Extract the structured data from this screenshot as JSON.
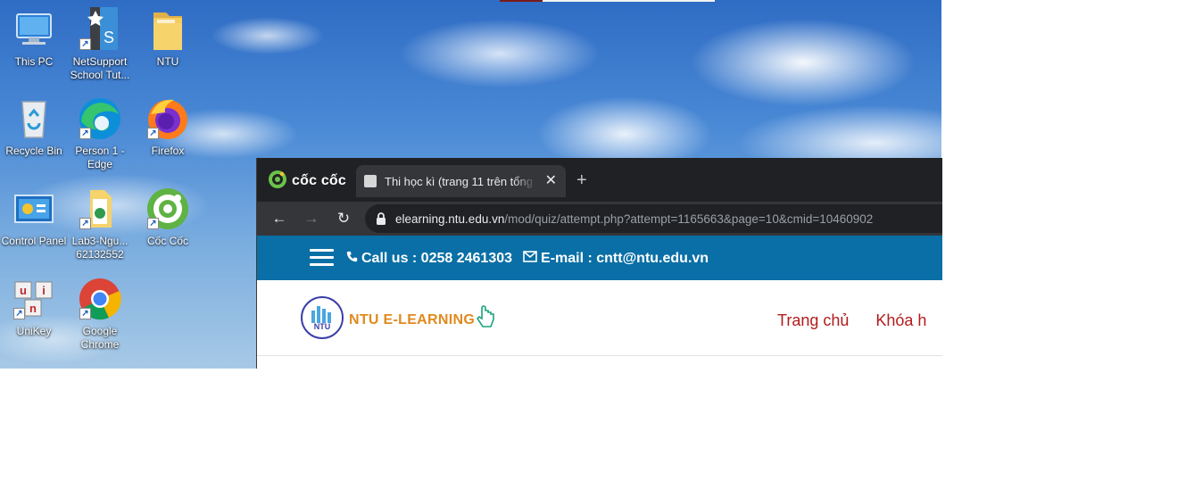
{
  "desktop": {
    "icons": [
      {
        "label": "This PC",
        "icon": "this-pc-icon"
      },
      {
        "label": "NetSupport School Tut...",
        "icon": "netsupport-icon"
      },
      {
        "label": "NTU",
        "icon": "folder-icon"
      },
      {
        "label": "Recycle Bin",
        "icon": "recycle-bin-icon"
      },
      {
        "label": "Person 1 - Edge",
        "icon": "edge-icon"
      },
      {
        "label": "Firefox",
        "icon": "firefox-icon"
      },
      {
        "label": "Control Panel",
        "icon": "control-panel-icon"
      },
      {
        "label": "Lab3-Ngu... 62132552",
        "icon": "document-icon"
      },
      {
        "label": "Cốc Cốc",
        "icon": "coccoc-icon"
      },
      {
        "label": "UniKey",
        "icon": "unikey-icon"
      },
      {
        "label": "Google Chrome",
        "icon": "chrome-icon"
      }
    ]
  },
  "browser": {
    "brand": "cốc cốc",
    "tab": {
      "title": "Thi học kì (trang 11 trên tổng",
      "close": "✕"
    },
    "new_tab": "+",
    "nav": {
      "back": "←",
      "forward": "→",
      "reload": "↻"
    },
    "url": {
      "host": "elearning.ntu.edu.vn",
      "path": "/mod/quiz/attempt.php?attempt=1165663&page=10&cmid=10460902"
    }
  },
  "site": {
    "phone_text": "Call us : 0258 2461303",
    "email_text": "E-mail : cntt@ntu.edu.vn",
    "logo_text": "NTU E-LEARNING",
    "logo_badge": "NTU",
    "menu": [
      "Trang chủ",
      "Khóa h"
    ],
    "colors": {
      "topbar": "#0a6fa6",
      "menu": "#b31b1b",
      "logo_text": "#e08a1e"
    }
  }
}
